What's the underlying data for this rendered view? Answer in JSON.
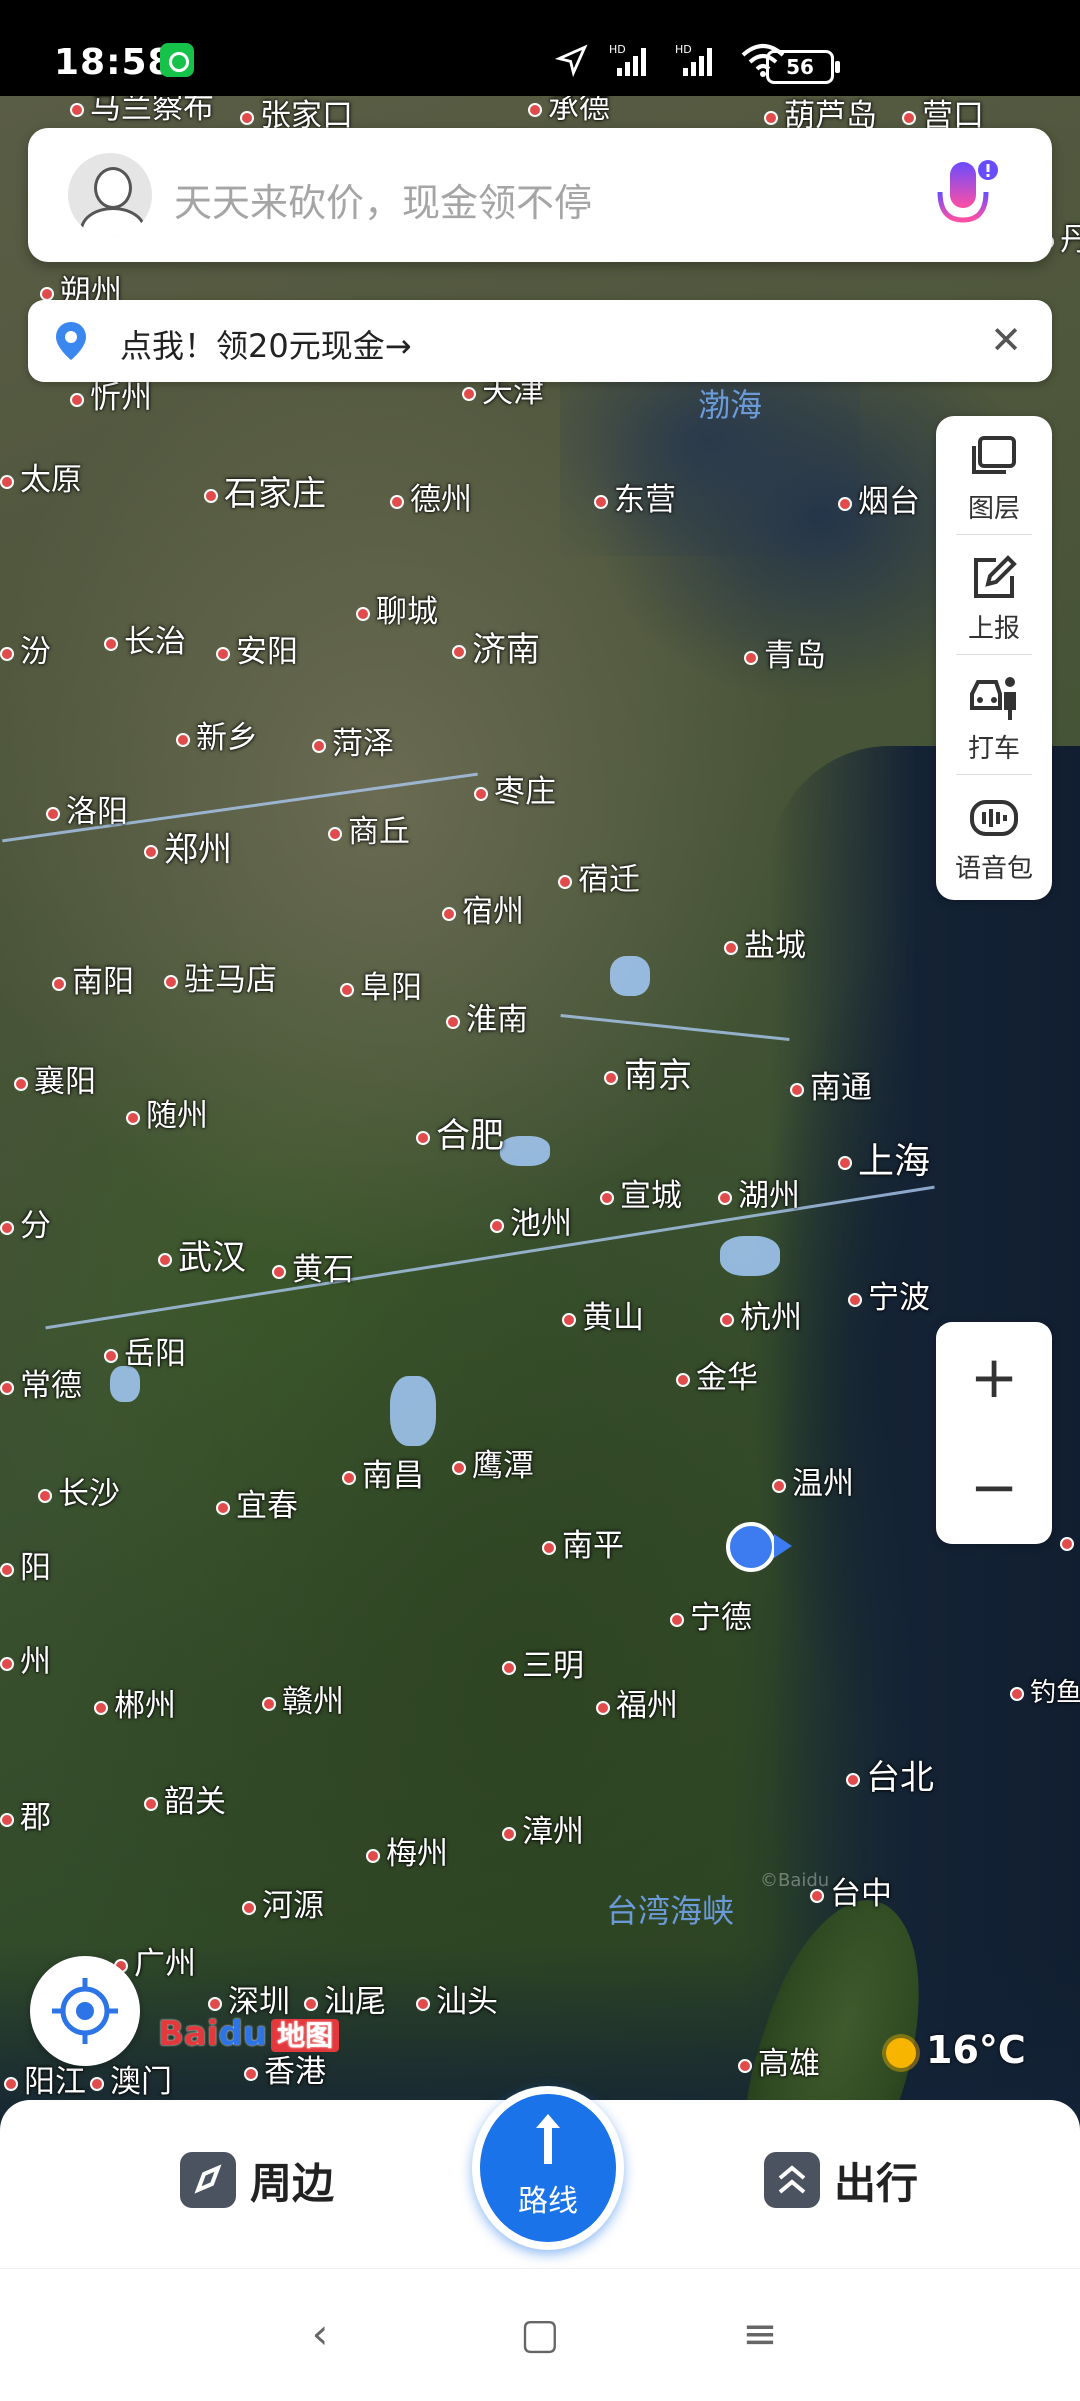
{
  "status_bar": {
    "time": "18:58",
    "battery": "56",
    "icons": [
      "location-arrow-icon",
      "signal-hd-1-icon",
      "signal-hd-2-icon",
      "wifi-icon",
      "battery-icon"
    ]
  },
  "search": {
    "placeholder": "天天来砍价，现金领不停",
    "mic_icon": "voice-mic-icon"
  },
  "promo": {
    "text": "点我！领20元现金→"
  },
  "toolbox": {
    "items": [
      {
        "label": "图层",
        "icon": "layers-icon"
      },
      {
        "label": "上报",
        "icon": "report-edit-icon"
      },
      {
        "label": "打车",
        "icon": "taxi-icon"
      },
      {
        "label": "语音包",
        "icon": "voice-pack-icon"
      }
    ]
  },
  "zoom": {
    "in": "+",
    "out": "−"
  },
  "map": {
    "seas": [
      "渤海",
      "台湾海峡"
    ],
    "cities": [
      "马兰察布",
      "张家口",
      "承德",
      "葫芦岛",
      "营口",
      "朔州",
      "忻州",
      "天津",
      "太原",
      "石家庄",
      "德州",
      "东营",
      "烟台",
      "聊城",
      "长治",
      "安阳",
      "济南",
      "青岛",
      "新乡",
      "菏泽",
      "洛阳",
      "郑州",
      "商丘",
      "枣庄",
      "宿迁",
      "宿州",
      "南阳",
      "驻马店",
      "阜阳",
      "淮南",
      "盐城",
      "襄阳",
      "随州",
      "合肥",
      "南京",
      "南通",
      "上海",
      "池州",
      "宣城",
      "湖州",
      "武汉",
      "黄石",
      "黄山",
      "杭州",
      "宁波",
      "岳阳",
      "常德",
      "金华",
      "温州",
      "长沙",
      "宜春",
      "南昌",
      "鹰潭",
      "南平",
      "宁德",
      "三明",
      "郴州",
      "赣州",
      "福州",
      "韶关",
      "梅州",
      "漳州",
      "台北",
      "台中",
      "河源",
      "广州",
      "深圳",
      "汕尾",
      "汕头",
      "香港",
      "阳江",
      "澳门",
      "高雄",
      "钓鱼岛",
      "阳",
      "州",
      "汾",
      "分",
      "郡",
      "丹东",
      "东"
    ],
    "watermark": "©Baidu",
    "logo": {
      "text": "Bai",
      "paw": "du",
      "suffix": "地图"
    }
  },
  "weather": {
    "temp": "16°C"
  },
  "bottom_nav": {
    "nearby": "周边",
    "route": "路线",
    "travel": "出行"
  },
  "system_nav": {
    "back": "‹",
    "home": "▢",
    "menu": "≡"
  },
  "colors": {
    "accent": "#1a73e8",
    "city_dot": "#e24b4b",
    "sea_label": "#6b9ad8"
  }
}
